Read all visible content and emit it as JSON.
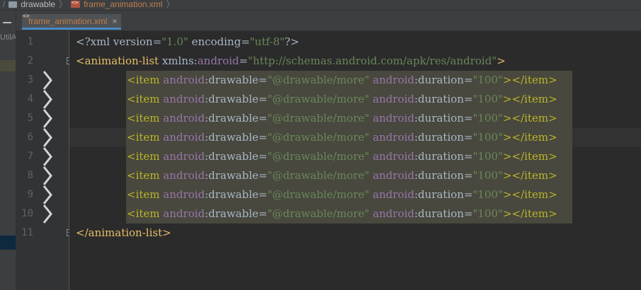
{
  "breadcrumb": {
    "folder": "drawable",
    "file": "frame_animation.xml"
  },
  "tab": {
    "label": "frame_animation.xml",
    "close": "×"
  },
  "left_panel": {
    "label": "UtilA"
  },
  "editor": {
    "line_numbers": [
      "1",
      "2",
      "3",
      "4",
      "5",
      "6",
      "7",
      "8",
      "9",
      "10",
      "11"
    ],
    "current_line": 6,
    "xml_decl": {
      "open": "<?xml ",
      "attr1": "version=",
      "val1": "\"1.0\"",
      "attr2": " encoding=",
      "val2": "\"utf-8\"",
      "close": "?>"
    },
    "root_open": {
      "tag": "<animation-list ",
      "ns_attr": "xmlns:",
      "ns_name": "android",
      "eq": "=",
      "ns_val": "\"http://schemas.android.com/apk/res/android\"",
      "close": ">"
    },
    "item_line": {
      "open": "<item ",
      "ns1": "android",
      "attr1": ":drawable=",
      "val1": "\"@drawable/more\"",
      "ns2": " android",
      "attr2": ":duration=",
      "val2": "\"100\"",
      "close": "></item>"
    },
    "root_close": "</animation-list>"
  }
}
